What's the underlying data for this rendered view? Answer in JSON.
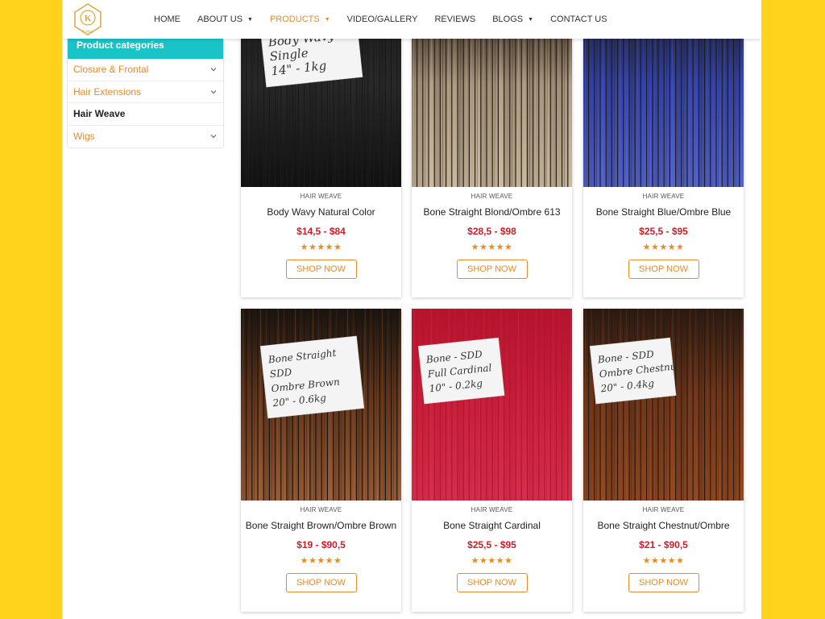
{
  "brand": {
    "logo_letter": "K",
    "logo_text": "K-Hair"
  },
  "nav": [
    {
      "label": "HOME",
      "caret": false,
      "active": false
    },
    {
      "label": "ABOUT US",
      "caret": true,
      "active": false
    },
    {
      "label": "PRODUCTS",
      "caret": true,
      "active": true
    },
    {
      "label": "VIDEO/GALLERY",
      "caret": false,
      "active": false
    },
    {
      "label": "REVIEWS",
      "caret": false,
      "active": false
    },
    {
      "label": "BLOGS",
      "caret": true,
      "active": false
    },
    {
      "label": "CONTACT US",
      "caret": false,
      "active": false
    }
  ],
  "sidebar": {
    "title": "Product categories",
    "items": [
      {
        "label": "Closure & Frontal",
        "expandable": true,
        "current": false
      },
      {
        "label": "Hair Extensions",
        "expandable": true,
        "current": false
      },
      {
        "label": "Hair Weave",
        "expandable": false,
        "current": true
      },
      {
        "label": "Wigs",
        "expandable": true,
        "current": false
      }
    ]
  },
  "products": [
    {
      "category": "HAIR WEAVE",
      "name": "Body Wavy Natural Color",
      "price": "$14,5 - $84",
      "rating": "★★★★★",
      "button": "SHOP NOW",
      "image": {
        "colors": [
          "#1a1a1a",
          "#2b2b2b",
          "#0f0f0f"
        ],
        "label_lines": [
          "Body Wavy",
          "Single",
          "14\" - 1kg"
        ]
      }
    },
    {
      "category": "HAIR WEAVE",
      "name": "Bone Straight Blond/Ombre 613",
      "price": "$28,5 - $98",
      "rating": "★★★★★",
      "button": "SHOP NOW",
      "image": {
        "colors": [
          "#2a1e17",
          "#b7a58a",
          "#d6c6a9"
        ],
        "label_lines": []
      }
    },
    {
      "category": "HAIR WEAVE",
      "name": "Bone Straight Blue/Ombre Blue",
      "price": "$25,5 - $95",
      "rating": "★★★★★",
      "button": "SHOP NOW",
      "image": {
        "colors": [
          "#1c1c24",
          "#3848b8",
          "#5a6ad8"
        ],
        "label_lines": []
      }
    },
    {
      "category": "HAIR WEAVE",
      "name": "Bone Straight Brown/Ombre Brown",
      "price": "$19 - $90,5",
      "rating": "★★★★★",
      "button": "SHOP NOW",
      "image": {
        "colors": [
          "#1a1410",
          "#6b3a1c",
          "#a8663a"
        ],
        "label_lines": [
          "Bone Straight",
          "SDD",
          "Ombre Brown",
          "20\" - 0.6kg"
        ]
      }
    },
    {
      "category": "HAIR WEAVE",
      "name": "Bone Straight Cardinal",
      "price": "$25,5 - $95",
      "rating": "★★★★★",
      "button": "SHOP NOW",
      "image": {
        "colors": [
          "#b5142e",
          "#c9203c",
          "#d83250"
        ],
        "label_lines": [
          "Bone - SDD",
          "Full Cardinal",
          "10\" - 0.2kg"
        ]
      }
    },
    {
      "category": "HAIR WEAVE",
      "name": "Bone Straight Chestnut/Ombre",
      "price": "$21 - $90,5",
      "rating": "★★★★★",
      "button": "SHOP NOW",
      "image": {
        "colors": [
          "#2a1a12",
          "#7a3a1a",
          "#9c4e22"
        ],
        "label_lines": [
          "Bone - SDD",
          "Ombre Chestnut",
          "20\" - 0.4kg"
        ]
      }
    }
  ]
}
